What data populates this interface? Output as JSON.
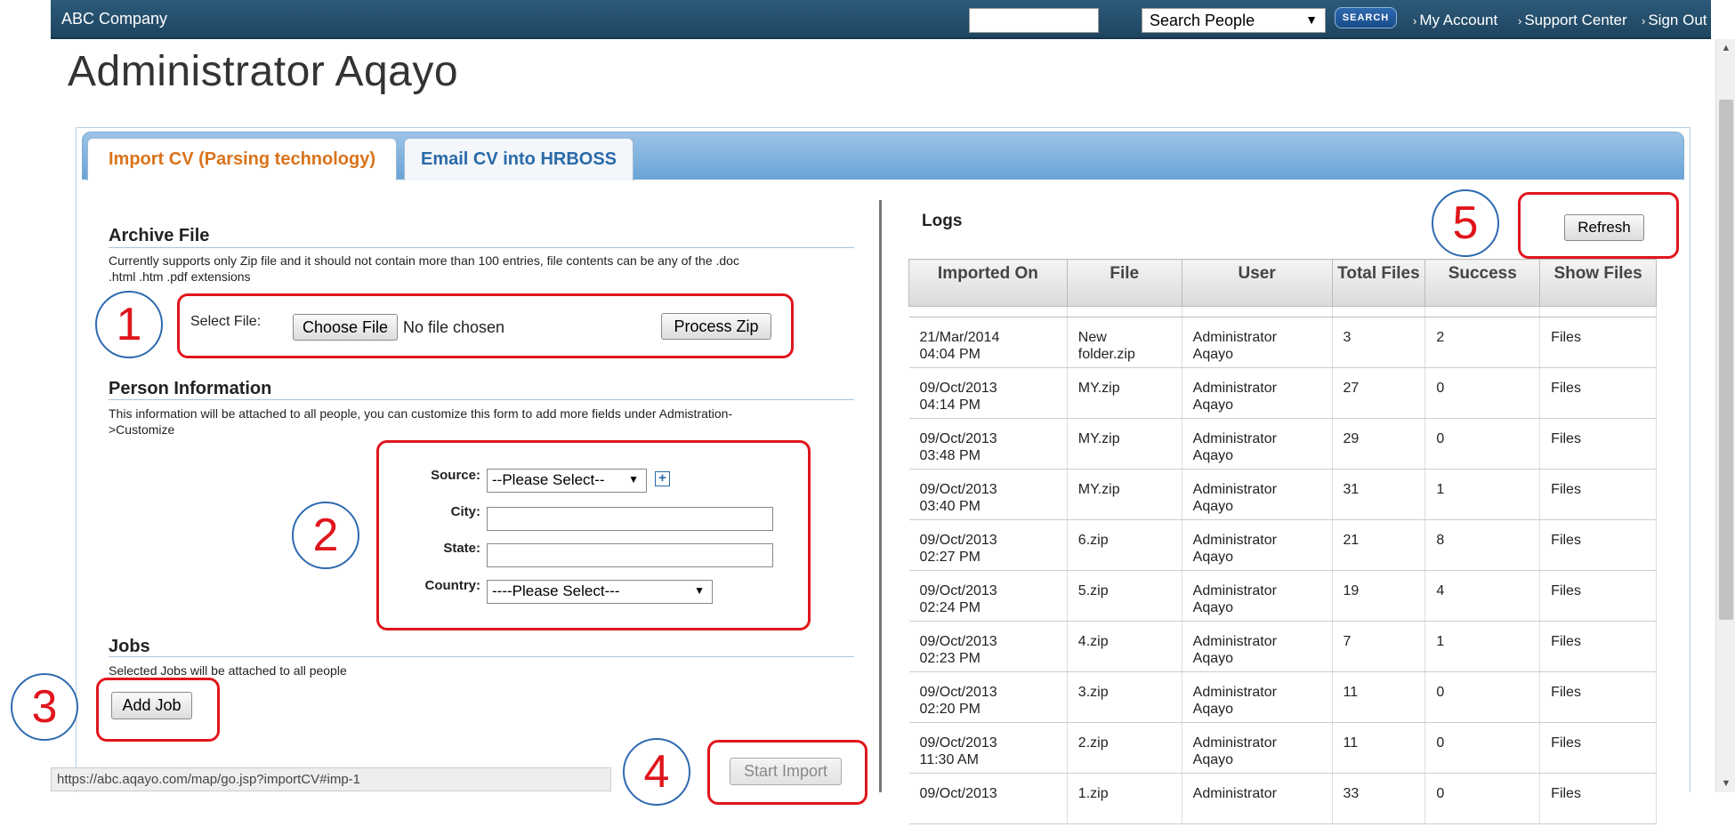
{
  "topbar": {
    "brand": "ABC Company",
    "search_select": "Search People",
    "search_button": "SEARCH",
    "links": [
      "My Account",
      "Support Center",
      "Sign Out"
    ]
  },
  "page": {
    "title": "Administrator Aqayo"
  },
  "tabs": [
    {
      "label": "Import CV (Parsing technology)",
      "active": true
    },
    {
      "label": "Email CV into HRBOSS",
      "active": false
    }
  ],
  "archive": {
    "title": "Archive File",
    "desc_line1": "Currently supports only Zip file and it should not contain more than 100 entries, file contents can be any of the .doc",
    "desc_line2": ".html .htm .pdf extensions",
    "select_label": "Select File:",
    "choose_button": "Choose File",
    "no_file": "No file chosen",
    "process_button": "Process Zip"
  },
  "person": {
    "title": "Person Information",
    "desc_line1": "This information will be attached to all people, you can customize this form to add more fields under Admistration-",
    "desc_line2": ">Customize",
    "source_label": "Source:",
    "source_value": "--Please Select--",
    "city_label": "City:",
    "state_label": "State:",
    "country_label": "Country:",
    "country_value": "----Please Select---"
  },
  "jobs": {
    "title": "Jobs",
    "desc": "Selected Jobs will be attached to all people",
    "add_button": "Add Job"
  },
  "start_import": "Start Import",
  "logs": {
    "title": "Logs",
    "refresh": "Refresh",
    "headers": [
      "Imported On",
      "File",
      "User",
      "Total Files",
      "Success",
      "Show Files"
    ],
    "rows": [
      {
        "date": "21/Mar/2014",
        "time": "04:04 PM",
        "file1": "New",
        "file2": "folder.zip",
        "user1": "Administrator",
        "user2": "Aqayo",
        "total": "3",
        "success": "2",
        "show": "Files"
      },
      {
        "date": "09/Oct/2013",
        "time": "04:14 PM",
        "file1": "MY.zip",
        "file2": "",
        "user1": "Administrator",
        "user2": "Aqayo",
        "total": "27",
        "success": "0",
        "show": "Files"
      },
      {
        "date": "09/Oct/2013",
        "time": "03:48 PM",
        "file1": "MY.zip",
        "file2": "",
        "user1": "Administrator",
        "user2": "Aqayo",
        "total": "29",
        "success": "0",
        "show": "Files"
      },
      {
        "date": "09/Oct/2013",
        "time": "03:40 PM",
        "file1": "MY.zip",
        "file2": "",
        "user1": "Administrator",
        "user2": "Aqayo",
        "total": "31",
        "success": "1",
        "show": "Files"
      },
      {
        "date": "09/Oct/2013",
        "time": "02:27 PM",
        "file1": "6.zip",
        "file2": "",
        "user1": "Administrator",
        "user2": "Aqayo",
        "total": "21",
        "success": "8",
        "show": "Files"
      },
      {
        "date": "09/Oct/2013",
        "time": "02:24 PM",
        "file1": "5.zip",
        "file2": "",
        "user1": "Administrator",
        "user2": "Aqayo",
        "total": "19",
        "success": "4",
        "show": "Files"
      },
      {
        "date": "09/Oct/2013",
        "time": "02:23 PM",
        "file1": "4.zip",
        "file2": "",
        "user1": "Administrator",
        "user2": "Aqayo",
        "total": "7",
        "success": "1",
        "show": "Files"
      },
      {
        "date": "09/Oct/2013",
        "time": "02:20 PM",
        "file1": "3.zip",
        "file2": "",
        "user1": "Administrator",
        "user2": "Aqayo",
        "total": "11",
        "success": "0",
        "show": "Files"
      },
      {
        "date": "09/Oct/2013",
        "time": "11:30 AM",
        "file1": "2.zip",
        "file2": "",
        "user1": "Administrator",
        "user2": "Aqayo",
        "total": "11",
        "success": "0",
        "show": "Files"
      },
      {
        "date": "09/Oct/2013",
        "time": "",
        "file1": "1.zip",
        "file2": "",
        "user1": "Administrator",
        "user2": "",
        "total": "33",
        "success": "0",
        "show": "Files"
      }
    ]
  },
  "callouts": [
    "1",
    "2",
    "3",
    "4",
    "5"
  ],
  "status_url": "https://abc.aqayo.com/map/go.jsp?importCV#imp-1",
  "colors": {
    "accent_red": "#e0151c",
    "header_blue": "#1e4560",
    "tab_orange": "#d9731a"
  }
}
